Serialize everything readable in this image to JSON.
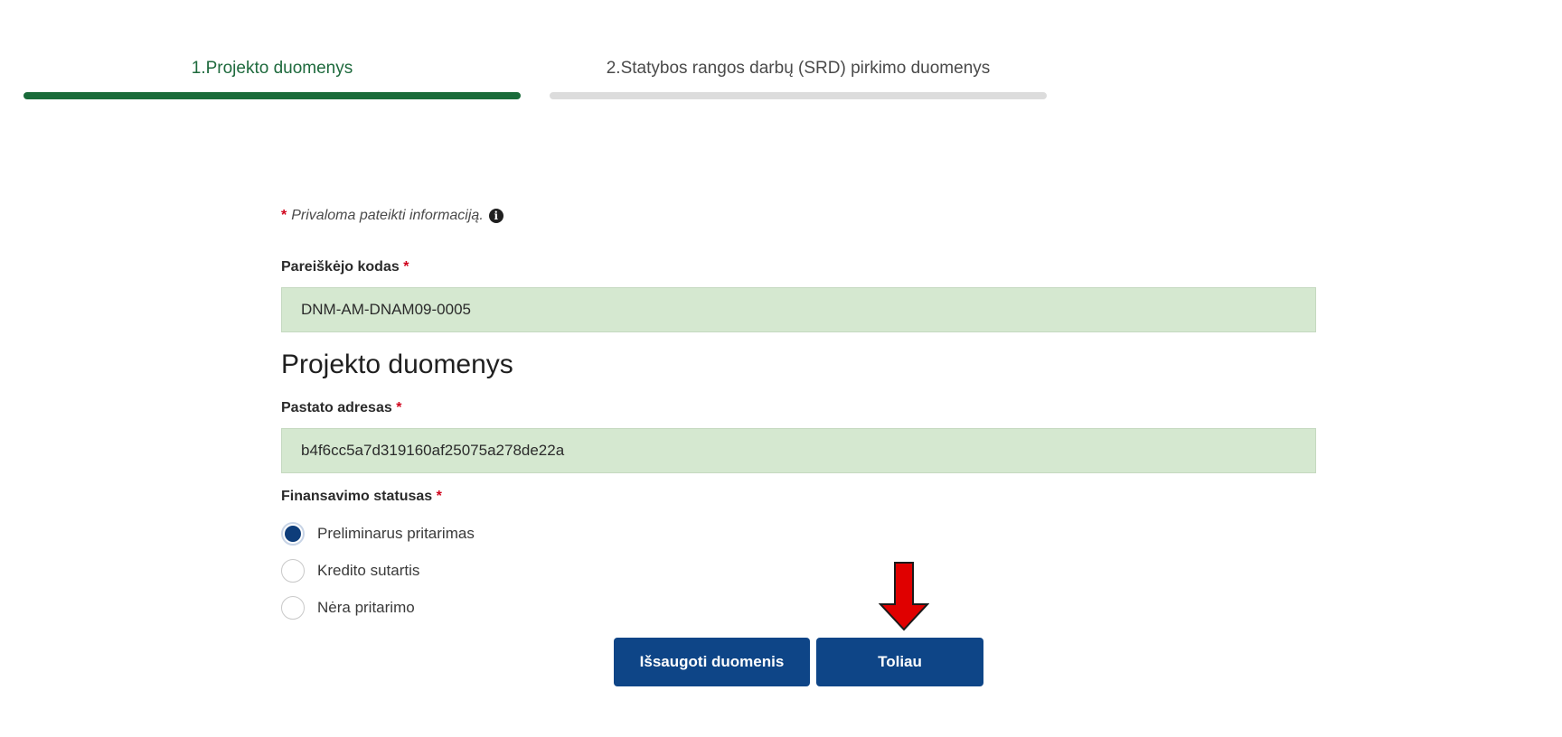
{
  "stepper": {
    "steps": [
      {
        "label": "1.Projekto duomenys",
        "active": true
      },
      {
        "label": "2.Statybos rangos darbų (SRD) pirkimo duomenys",
        "active": false
      }
    ]
  },
  "form": {
    "required_star": "*",
    "required_note": "Privaloma pateikti informaciją.",
    "info_icon_glyph": "i",
    "applicant_code": {
      "label": "Pareiškėjo kodas",
      "value": "DNM-AM-DNAM09-0005"
    },
    "section_title": "Projekto duomenys",
    "building_address": {
      "label": "Pastato adresas",
      "value": "b4f6cc5a7d319160af25075a278de22a"
    },
    "funding_status": {
      "label": "Finansavimo statusas",
      "selected": "Preliminarus pritarimas",
      "options": [
        "Preliminarus pritarimas",
        "Kredito sutartis",
        "Nėra pritarimo"
      ]
    }
  },
  "buttons": {
    "save_label": "Išsaugoti duomenis",
    "next_label": "Toliau"
  },
  "colors": {
    "active_step": "#1a6b3a",
    "inactive_step": "#dcdcdc",
    "input_bg": "#d5e8d0",
    "button_bg": "#0e4587",
    "required": "#d0021b",
    "arrow": "#e00000"
  },
  "icons": {
    "info": "info-circle-icon",
    "annotation": "red-down-arrow-icon"
  }
}
